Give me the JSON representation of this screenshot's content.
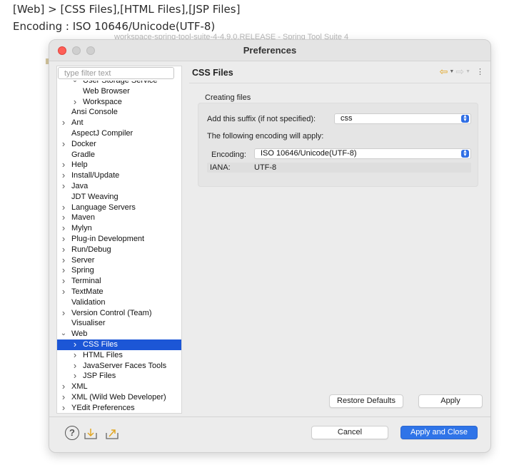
{
  "caption": {
    "line1": "[Web] > [CSS Files],[HTML Files],[JSP Files]",
    "line2": "Encoding : ISO 10646/Unicode(UTF-8)"
  },
  "background_window_title": "workspace-spring-tool-suite-4-4.9.0.RELEASE - Spring Tool Suite 4",
  "window": {
    "title": "Preferences",
    "filter_placeholder": "type filter text"
  },
  "tree": [
    {
      "label": "User Storage Service",
      "indent": 2,
      "chevron": "expanded",
      "clipped": true
    },
    {
      "label": "Web Browser",
      "indent": 2,
      "chevron": "none"
    },
    {
      "label": "Workspace",
      "indent": 2,
      "chevron": "collapsed"
    },
    {
      "label": "Ansi Console",
      "indent": 1,
      "chevron": "none"
    },
    {
      "label": "Ant",
      "indent": 1,
      "chevron": "collapsed"
    },
    {
      "label": "AspectJ Compiler",
      "indent": 1,
      "chevron": "none"
    },
    {
      "label": "Docker",
      "indent": 1,
      "chevron": "collapsed"
    },
    {
      "label": "Gradle",
      "indent": 1,
      "chevron": "none"
    },
    {
      "label": "Help",
      "indent": 1,
      "chevron": "collapsed"
    },
    {
      "label": "Install/Update",
      "indent": 1,
      "chevron": "collapsed"
    },
    {
      "label": "Java",
      "indent": 1,
      "chevron": "collapsed"
    },
    {
      "label": "JDT Weaving",
      "indent": 1,
      "chevron": "none"
    },
    {
      "label": "Language Servers",
      "indent": 1,
      "chevron": "collapsed"
    },
    {
      "label": "Maven",
      "indent": 1,
      "chevron": "collapsed"
    },
    {
      "label": "Mylyn",
      "indent": 1,
      "chevron": "collapsed"
    },
    {
      "label": "Plug-in Development",
      "indent": 1,
      "chevron": "collapsed"
    },
    {
      "label": "Run/Debug",
      "indent": 1,
      "chevron": "collapsed"
    },
    {
      "label": "Server",
      "indent": 1,
      "chevron": "collapsed"
    },
    {
      "label": "Spring",
      "indent": 1,
      "chevron": "collapsed"
    },
    {
      "label": "Terminal",
      "indent": 1,
      "chevron": "collapsed"
    },
    {
      "label": "TextMate",
      "indent": 1,
      "chevron": "collapsed"
    },
    {
      "label": "Validation",
      "indent": 1,
      "chevron": "none"
    },
    {
      "label": "Version Control (Team)",
      "indent": 1,
      "chevron": "collapsed"
    },
    {
      "label": "Visualiser",
      "indent": 1,
      "chevron": "none"
    },
    {
      "label": "Web",
      "indent": 1,
      "chevron": "expanded"
    },
    {
      "label": "CSS Files",
      "indent": 2,
      "chevron": "collapsed",
      "selected": true
    },
    {
      "label": "HTML Files",
      "indent": 2,
      "chevron": "collapsed"
    },
    {
      "label": "JavaServer Faces Tools",
      "indent": 2,
      "chevron": "collapsed"
    },
    {
      "label": "JSP Files",
      "indent": 2,
      "chevron": "collapsed"
    },
    {
      "label": "XML",
      "indent": 1,
      "chevron": "collapsed"
    },
    {
      "label": "XML (Wild Web Developer)",
      "indent": 1,
      "chevron": "collapsed"
    },
    {
      "label": "YEdit Preferences",
      "indent": 1,
      "chevron": "collapsed"
    }
  ],
  "page": {
    "title": "CSS Files",
    "section_label": "Creating files",
    "suffix_label": "Add this suffix (if not specified):",
    "suffix_value": "css",
    "encoding_note": "The following encoding will apply:",
    "encoding_label": "Encoding:",
    "encoding_value": "ISO 10646/Unicode(UTF-8)",
    "iana_label": "IANA:",
    "iana_value": "UTF-8"
  },
  "buttons": {
    "restore_defaults": "Restore Defaults",
    "apply": "Apply",
    "cancel": "Cancel",
    "apply_and_close": "Apply and Close"
  },
  "colors": {
    "selection": "#1c56d6",
    "primary_button": "#2f74e8",
    "back_arrow": "#e2a623",
    "close_button": "#fe5f57"
  },
  "icons": {
    "help": "help-icon",
    "import": "import-icon",
    "export": "export-icon",
    "back": "back-arrow-icon",
    "forward": "forward-arrow-icon",
    "menu": "view-menu-icon"
  }
}
